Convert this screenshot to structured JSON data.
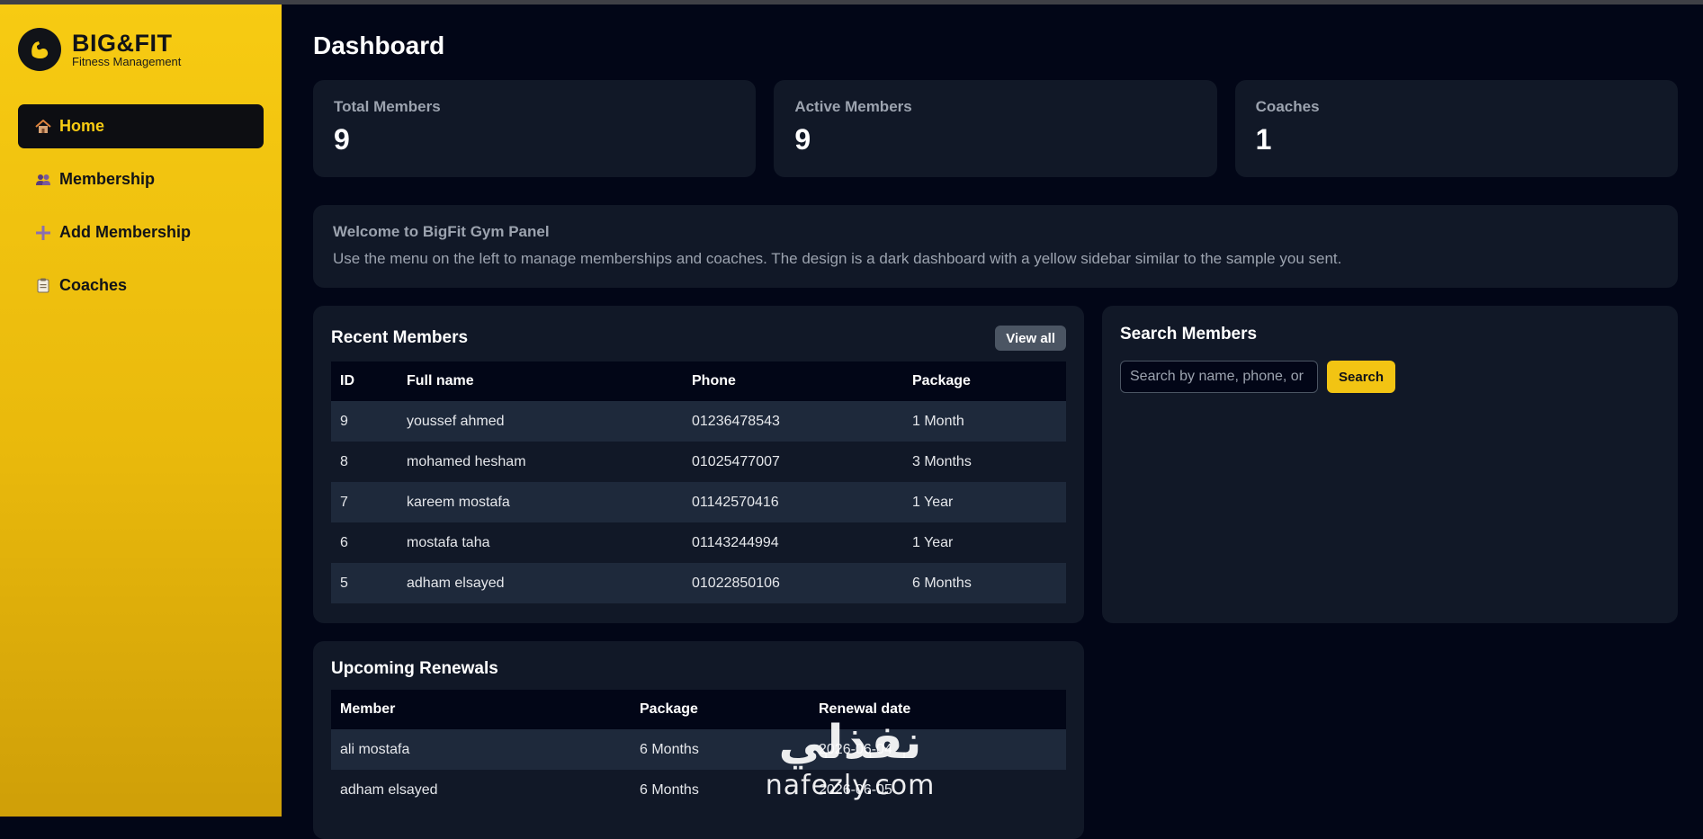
{
  "brand": {
    "title": "BIG&FIT",
    "subtitle": "Fitness Management",
    "logo_icon": "flexed-biceps-icon"
  },
  "sidebar": {
    "items": [
      {
        "label": "Home",
        "icon": "house-icon",
        "active": true
      },
      {
        "label": "Membership",
        "icon": "users-icon",
        "active": false
      },
      {
        "label": "Add Membership",
        "icon": "plus-icon",
        "active": false
      },
      {
        "label": "Coaches",
        "icon": "clipboard-icon",
        "active": false
      }
    ]
  },
  "page": {
    "title": "Dashboard"
  },
  "stats": [
    {
      "label": "Total Members",
      "value": "9"
    },
    {
      "label": "Active Members",
      "value": "9"
    },
    {
      "label": "Coaches",
      "value": "1"
    }
  ],
  "welcome": {
    "title": "Welcome to BigFit Gym Panel",
    "text": "Use the menu on the left to manage memberships and coaches. The design is a dark dashboard with a yellow sidebar similar to the sample you sent."
  },
  "recent_members": {
    "title": "Recent Members",
    "view_all_label": "View all",
    "columns": [
      "ID",
      "Full name",
      "Phone",
      "Package"
    ],
    "rows": [
      [
        "9",
        "youssef ahmed",
        "01236478543",
        "1 Month"
      ],
      [
        "8",
        "mohamed hesham",
        "01025477007",
        "3 Months"
      ],
      [
        "7",
        "kareem mostafa",
        "01142570416",
        "1 Year"
      ],
      [
        "6",
        "mostafa taha",
        "01143244994",
        "1 Year"
      ],
      [
        "5",
        "adham elsayed",
        "01022850106",
        "6 Months"
      ]
    ]
  },
  "search": {
    "title": "Search Members",
    "placeholder": "Search by name, phone, or",
    "value": "",
    "button_label": "Search"
  },
  "renewals": {
    "title": "Upcoming Renewals",
    "columns": [
      "Member",
      "Package",
      "Renewal date"
    ],
    "rows": [
      [
        "ali mostafa",
        "6 Months",
        "2026-06-04"
      ],
      [
        "adham elsayed",
        "6 Months",
        "2026-06-05"
      ]
    ]
  },
  "watermark": {
    "arabic": "نفذلي",
    "latin": "nafezly.com"
  },
  "colors": {
    "sidebar": "#f7cb12",
    "background": "#020617",
    "card": "#111827",
    "accent": "#f2c413"
  }
}
